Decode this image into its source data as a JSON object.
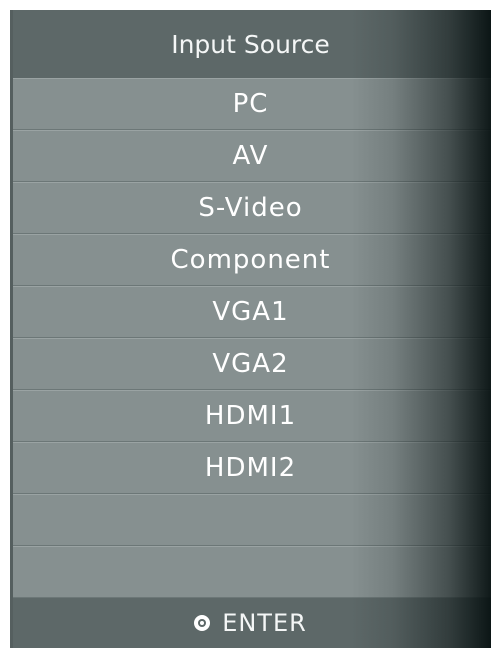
{
  "title": "Input Source",
  "items": [
    {
      "label": "PC"
    },
    {
      "label": "AV"
    },
    {
      "label": "S-Video"
    },
    {
      "label": "Component"
    },
    {
      "label": "VGA1"
    },
    {
      "label": "VGA2"
    },
    {
      "label": "HDMI1"
    },
    {
      "label": "HDMI2"
    },
    {
      "label": ""
    },
    {
      "label": ""
    }
  ],
  "footer": {
    "icon": "enter-button-icon",
    "label": "ENTER"
  },
  "colors": {
    "panel": "#869090",
    "header": "#5d6868",
    "text": "#ffffff"
  }
}
